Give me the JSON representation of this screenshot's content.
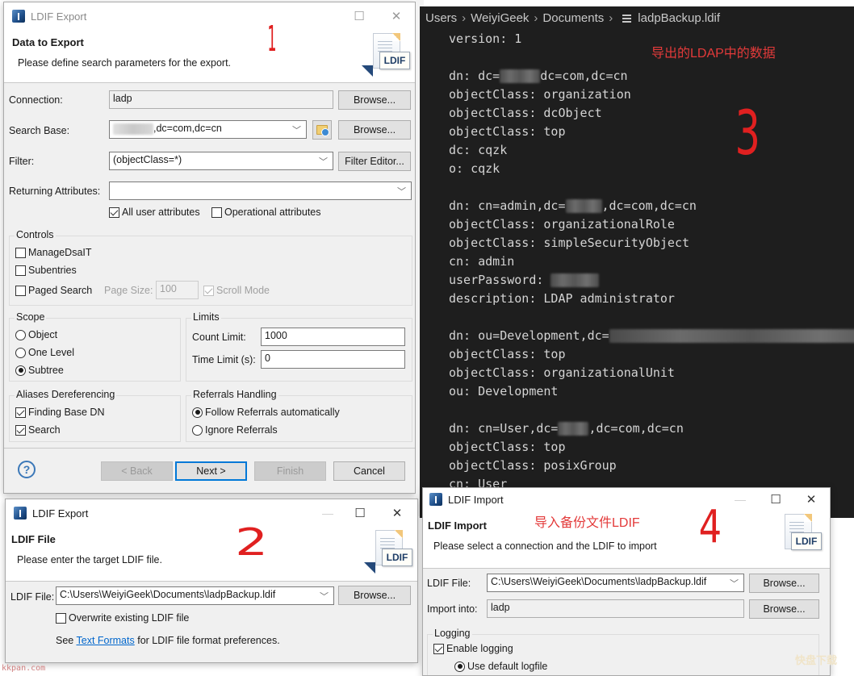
{
  "export_dialog_1": {
    "window_title": "LDIF Export",
    "header_title": "Data to Export",
    "header_desc": "Please define search parameters for the export.",
    "banner_tag": "LDIF",
    "annotation_number": "1",
    "connection": {
      "label": "Connection:",
      "value": "ladp",
      "browse": "Browse..."
    },
    "search_base": {
      "label": "Search Base:",
      "value": ",dc=com,dc=cn",
      "browse": "Browse..."
    },
    "filter": {
      "label": "Filter:",
      "value": "(objectClass=*)",
      "editor_button": "Filter Editor..."
    },
    "returning_attributes": {
      "label": "Returning Attributes:",
      "value": ""
    },
    "all_user_attributes": {
      "label": "All user attributes",
      "checked": true
    },
    "operational_attributes": {
      "label": "Operational attributes",
      "checked": false
    },
    "controls": {
      "title": "Controls",
      "manage_dsait": {
        "label": "ManageDsaIT",
        "checked": false
      },
      "subentries": {
        "label": "Subentries",
        "checked": false
      },
      "paged_search": {
        "label": "Paged Search",
        "checked": false
      },
      "page_size_label": "Page Size:",
      "page_size_value": "100",
      "scroll_mode": {
        "label": "Scroll Mode",
        "checked": true
      }
    },
    "scope": {
      "title": "Scope",
      "options": [
        "Object",
        "One Level",
        "Subtree"
      ],
      "selected": "Subtree"
    },
    "limits": {
      "title": "Limits",
      "count_label": "Count Limit:",
      "count_value": "1000",
      "time_label": "Time Limit (s):",
      "time_value": "0"
    },
    "aliases": {
      "title": "Aliases Dereferencing",
      "finding_base_dn": {
        "label": "Finding Base DN",
        "checked": true
      },
      "search": {
        "label": "Search",
        "checked": true
      }
    },
    "referrals": {
      "title": "Referrals Handling",
      "options": [
        "Follow Referrals automatically",
        "Ignore Referrals"
      ],
      "selected": "Follow Referrals automatically"
    },
    "buttons": {
      "back": "< Back",
      "next": "Next >",
      "finish": "Finish",
      "cancel": "Cancel"
    },
    "help_icon": "?"
  },
  "export_dialog_2": {
    "window_title": "LDIF Export",
    "header_title": "LDIF File",
    "header_desc": "Please enter the target LDIF file.",
    "banner_tag": "LDIF",
    "annotation_number": "2",
    "ldif_file": {
      "label": "LDIF File:",
      "value": "C:\\Users\\WeiyiGeek\\Documents\\ladpBackup.ldif",
      "browse": "Browse..."
    },
    "overwrite": {
      "label": "Overwrite existing LDIF file",
      "checked": false
    },
    "see_prefix": "See",
    "see_link": "Text Formats",
    "see_suffix": "for LDIF file format preferences."
  },
  "editor": {
    "breadcrumb": [
      "Users",
      "WeiyiGeek",
      "Documents",
      "ladpBackup.ldif"
    ],
    "annotation_text": "导出的LDAP中的数据",
    "annotation_number": "3",
    "lines": [
      "version: 1",
      "",
      "dn: dc=[redacted]dc=com,dc=cn",
      "objectClass: organization",
      "objectClass: dcObject",
      "objectClass: top",
      "dc: cqzk",
      "o: cqzk",
      "",
      "dn: cn=admin,dc=[redacted],dc=com,dc=cn",
      "objectClass: organizationalRole",
      "objectClass: simpleSecurityObject",
      "cn: admin",
      "userPassword: [redacted]",
      "description: LDAP administrator",
      "",
      "dn: ou=Development,dc=[redacted]dc=com,dc=cn",
      "objectClass: top",
      "objectClass: organizationalUnit",
      "ou: Development",
      "",
      "dn: cn=User,dc=[redacted],dc=com,dc=cn",
      "objectClass: top",
      "objectClass: posixGroup",
      "cn: User"
    ]
  },
  "import_dialog": {
    "window_title": "LDIF Import",
    "header_title": "LDIF Import",
    "header_desc": "Please select a connection and the LDIF to import",
    "banner_tag": "LDIF",
    "annotation_text": "导入备份文件LDIF",
    "annotation_number": "4",
    "ldif_file": {
      "label": "LDIF File:",
      "value": "C:\\Users\\WeiyiGeek\\Documents\\ladpBackup.ldif",
      "browse": "Browse..."
    },
    "import_into": {
      "label": "Import into:",
      "value": "ladp",
      "browse": "Browse..."
    },
    "logging": {
      "title": "Logging",
      "enable": {
        "label": "Enable logging",
        "checked": true
      },
      "use_default": {
        "label": "Use default logfile",
        "selected": true
      }
    }
  },
  "watermark": "kkpan.com"
}
